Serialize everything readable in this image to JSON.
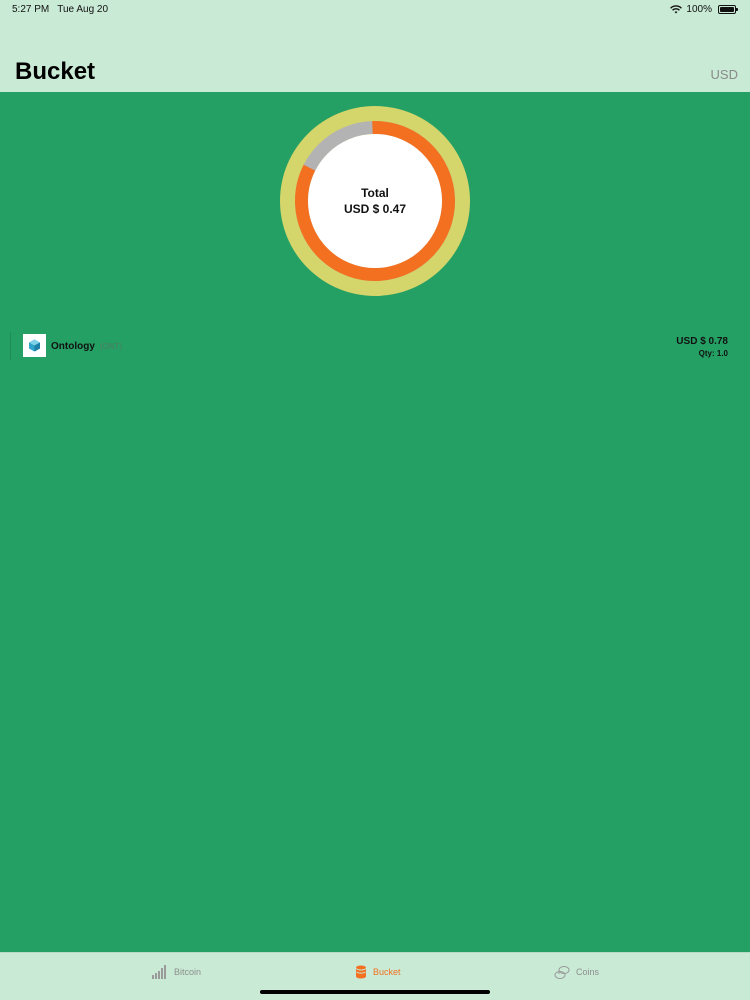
{
  "status_bar": {
    "time": "5:27 PM",
    "date": "Tue Aug 20",
    "battery": "100%"
  },
  "nav": {
    "title": "Bucket",
    "currency": "USD"
  },
  "summary": {
    "total_label": "Total",
    "total_value": "USD $ 0.47"
  },
  "holdings": [
    {
      "name": "Ontology",
      "symbol": "(ONT)",
      "value": "USD $ 0.78",
      "qty": "Qty: 1.0"
    }
  ],
  "tabs": [
    {
      "label": "Bitcoin",
      "active": false,
      "icon": "bar-chart-icon"
    },
    {
      "label": "Bucket",
      "active": true,
      "icon": "bucket-icon"
    },
    {
      "label": "Coins",
      "active": false,
      "icon": "coins-icon"
    }
  ],
  "colors": {
    "background_header": "#c9ead5",
    "background_content": "#25a064",
    "accent": "#f37021",
    "donut_outer": "#d4d56a",
    "donut_remainder": "#b3b3b3",
    "tab_inactive": "#8d8d8d"
  }
}
